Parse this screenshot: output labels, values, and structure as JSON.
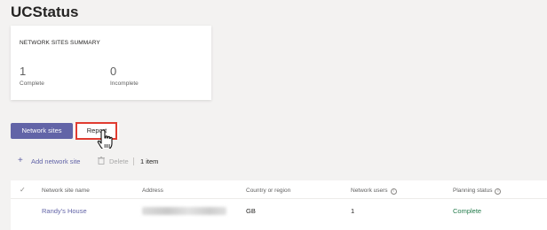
{
  "page": {
    "title": "UCStatus"
  },
  "summary": {
    "title": "NETWORK SITES SUMMARY",
    "complete": {
      "value": "1",
      "label": "Complete"
    },
    "incomplete": {
      "value": "0",
      "label": "Incomplete"
    }
  },
  "tabs": [
    {
      "label": "Network sites",
      "active": true
    },
    {
      "label": "Report",
      "active": false
    }
  ],
  "toolbar": {
    "add_label": "Add network site",
    "delete_label": "Delete",
    "item_count": "1 item"
  },
  "table": {
    "columns": [
      "Network site name",
      "Address",
      "Country or region",
      "Network users",
      "Planning status"
    ],
    "rows": [
      {
        "name": "Randy's House",
        "country": "GB",
        "users": "1",
        "status": "Complete"
      }
    ]
  },
  "colors": {
    "accent": "#6264a7",
    "highlight_box": "#e03c31",
    "status_complete": "#237b4b"
  },
  "icons": [
    "add-icon",
    "delete-icon",
    "check-icon",
    "info-icon",
    "hand-pointer-icon"
  ]
}
